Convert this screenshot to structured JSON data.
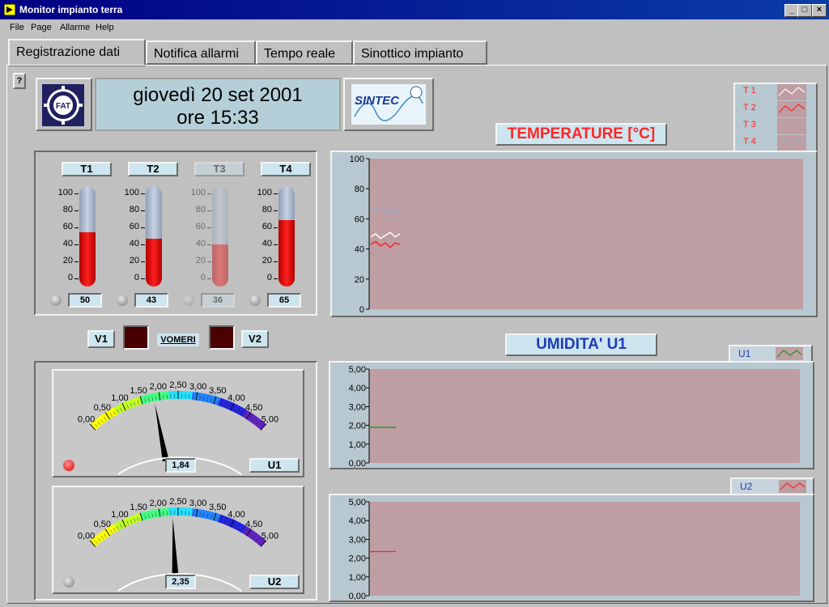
{
  "window": {
    "title": "Monitor impianto terra"
  },
  "menu": {
    "file": "File",
    "page": "Page",
    "allarme": "Allarme",
    "help": "Help"
  },
  "tabs": [
    "Registrazione dati",
    "Notifica allarmi",
    "Tempo reale",
    "Sinottico impianto"
  ],
  "help_button": "?",
  "header": {
    "date": "giovedì 20 set 2001",
    "time": "ore 15:33",
    "logo_left": "fiat-gear-logo",
    "logo_right": "SINTEC"
  },
  "thermometers": [
    {
      "label": "T1",
      "value": 50,
      "display": "50",
      "enabled": true
    },
    {
      "label": "T2",
      "value": 43,
      "display": "43",
      "enabled": true
    },
    {
      "label": "T3",
      "value": 36,
      "display": "36",
      "enabled": false
    },
    {
      "label": "T4",
      "value": 65,
      "display": "65",
      "enabled": true
    }
  ],
  "thermo_ticks": [
    "100",
    "80",
    "60",
    "40",
    "20",
    "0"
  ],
  "valves": {
    "v1": "V1",
    "v2": "V2",
    "vomeri": "VOMERI"
  },
  "temp_chart": {
    "title": "TEMPERATURE [°C]",
    "yticks": [
      "100",
      "80",
      "60",
      "40",
      "20",
      "0"
    ],
    "legend": [
      {
        "name": "T 1",
        "color": "#ffffff"
      },
      {
        "name": "T 2",
        "color": "#ff2020"
      },
      {
        "name": "T 3",
        "color": "#c8a0a0"
      },
      {
        "name": "T 4",
        "color": "#9aaed0"
      }
    ]
  },
  "humidity_title": "UMIDITA'  U1",
  "hum_charts": [
    {
      "legend": "U1",
      "color": "#1a9a1a",
      "value": 1.9
    },
    {
      "legend": "U2",
      "color": "#ff2020",
      "value": 2.35
    }
  ],
  "hum_yticks": [
    "5,00",
    "4,00",
    "3,00",
    "2,00",
    "1,00",
    "0,00"
  ],
  "gauges": [
    {
      "label": "U1",
      "value": 1.84,
      "display": "1,84",
      "led_on": true
    },
    {
      "label": "U2",
      "value": 2.35,
      "display": "2,35",
      "led_on": false
    }
  ],
  "gauge_scale": [
    "0,00",
    "0,50",
    "1,00",
    "1,50",
    "2,00",
    "2,50",
    "3,00",
    "3,50",
    "4,00",
    "4,50",
    "5,00"
  ],
  "chart_data": [
    {
      "type": "line",
      "title": "TEMPERATURE [°C]",
      "ylim": [
        0,
        100
      ],
      "series": [
        {
          "name": "T 1",
          "x": [
            0,
            1,
            2,
            3,
            4,
            5,
            6
          ],
          "values": [
            48,
            50,
            47,
            49,
            51,
            48,
            50
          ]
        },
        {
          "name": "T 2",
          "x": [
            0,
            1,
            2,
            3,
            4,
            5,
            6
          ],
          "values": [
            43,
            45,
            42,
            44,
            41,
            44,
            43
          ]
        },
        {
          "name": "T 4",
          "x": [
            0,
            1,
            2,
            3,
            4,
            5,
            6
          ],
          "values": [
            65,
            67,
            66,
            64,
            66,
            64,
            65
          ]
        }
      ]
    },
    {
      "type": "line",
      "ylim": [
        0,
        5
      ],
      "series": [
        {
          "name": "U1",
          "x": [
            0,
            6
          ],
          "values": [
            1.9,
            1.9
          ]
        }
      ]
    },
    {
      "type": "line",
      "ylim": [
        0,
        5
      ],
      "series": [
        {
          "name": "U2",
          "x": [
            0,
            6
          ],
          "values": [
            2.35,
            2.35
          ]
        }
      ]
    }
  ]
}
